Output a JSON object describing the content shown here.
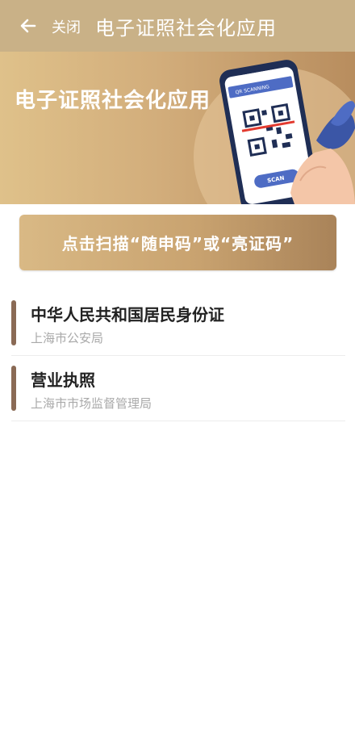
{
  "header": {
    "close_label": "关闭",
    "title": "电子证照社会化应用",
    "back_icon": "arrow-left-icon"
  },
  "banner": {
    "title": "电子证照社会化应用",
    "phone_screen_caption": "QR SCANNING",
    "phone_button_label": "SCAN"
  },
  "scan_button": {
    "label": "点击扫描“随申码”或“亮证码”"
  },
  "documents": [
    {
      "name": "中华人民共和国居民身份证",
      "issuer": "上海市公安局"
    },
    {
      "name": "营业执照",
      "issuer": "上海市市场监督管理局"
    }
  ],
  "colors": {
    "header_bg": "#c9b187",
    "accent_bar": "#8a6a55",
    "issuer_text": "#a9a9a9"
  }
}
